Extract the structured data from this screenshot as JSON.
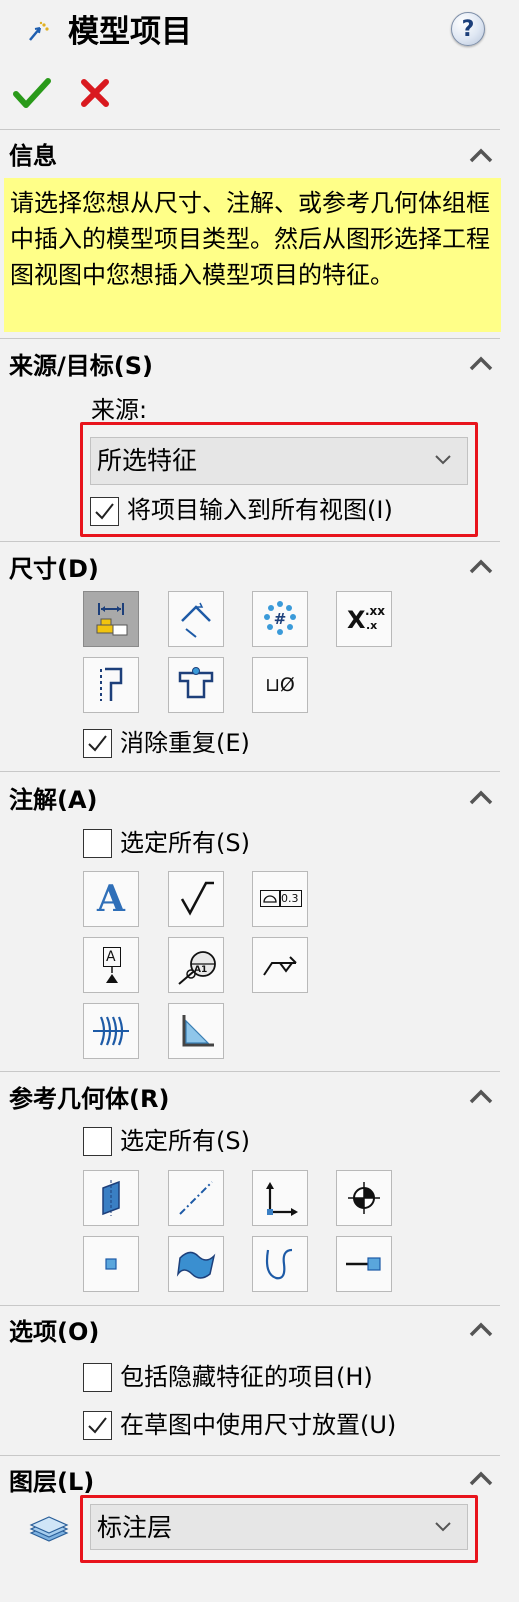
{
  "header": {
    "title": "模型项目",
    "help_glyph": "?",
    "ok_icon": "checkmark-icon",
    "cancel_icon": "x-icon"
  },
  "info": {
    "title": "信息",
    "text": "请选择您想从尺寸、注解、或参考几何体组框中插入的模型项目类型。然后从图形选择工程图视图中您想插入模型项目的特征。"
  },
  "source": {
    "title": "来源/目标(S)",
    "source_label": "来源:",
    "source_value": "所选特征",
    "import_all_label": "将项目输入到所有视图(I)",
    "import_all_checked": true
  },
  "dimensions": {
    "title": "尺寸(D)",
    "xx_text": "X",
    "xx_sup": ".xx",
    "xx_sub": ".x",
    "hole_text": "⊔Ø",
    "eliminate_label": "消除重复(E)",
    "eliminate_checked": true
  },
  "annotations": {
    "title": "注解(A)",
    "select_all_label": "选定所有(S)",
    "select_all_checked": false,
    "note_glyph": "A",
    "gtol_value": "0.3",
    "datum_glyph": "A",
    "balloon_glyph": "A1"
  },
  "reference": {
    "title": "参考几何体(R)",
    "select_all_label": "选定所有(S)",
    "select_all_checked": false
  },
  "options": {
    "title": "选项(O)",
    "hidden_label": "包括隐藏特征的项目(H)",
    "hidden_checked": false,
    "sketch_label": "在草图中使用尺寸放置(U)",
    "sketch_checked": true
  },
  "layer": {
    "title": "图层(L)",
    "value": "标注层",
    "icon": "layers-icon"
  },
  "colors": {
    "accent_green": "#2a9a1a",
    "cancel_red": "#d9191f",
    "highlight_red": "#e8141c",
    "info_yellow": "#ffff88"
  }
}
